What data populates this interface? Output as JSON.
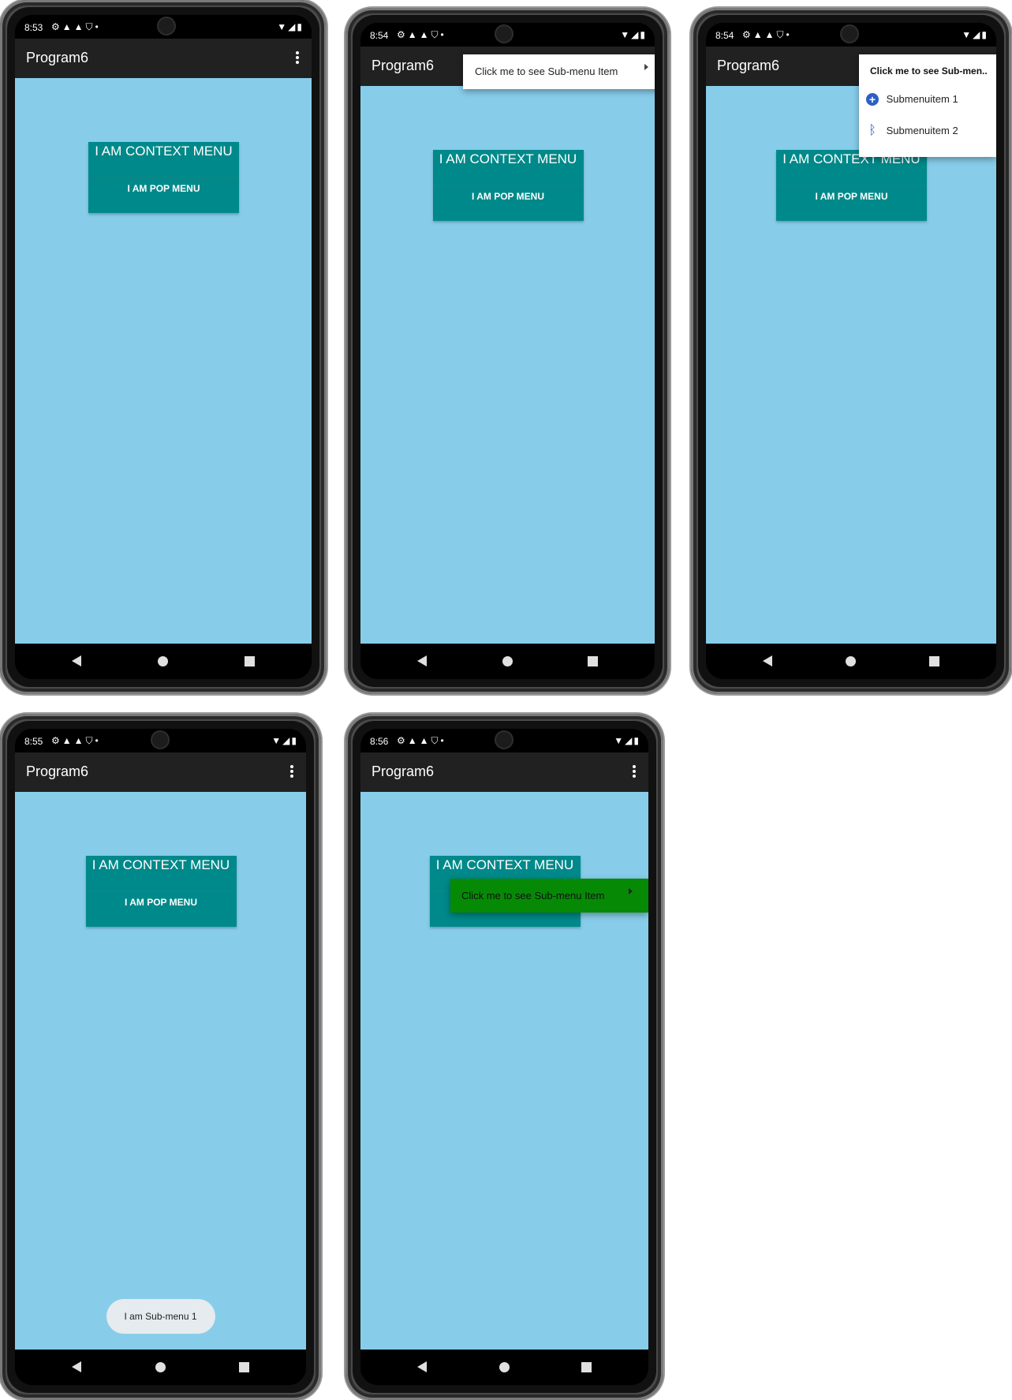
{
  "app": {
    "title": "Program6",
    "context_button_label": "I AM CONTEXT MENU",
    "popup_button_label": "I AM POP MENU"
  },
  "screens": [
    {
      "time": "8:53"
    },
    {
      "time": "8:54",
      "menu_item": "Click me to see Sub-menu Item"
    },
    {
      "time": "8:54",
      "submenu_header": "Click me to see Sub-men..",
      "submenu_items": [
        {
          "label": "Submenuitem 1",
          "icon": "add-circle-icon"
        },
        {
          "label": "Submenuitem 2",
          "icon": "bluetooth-icon"
        }
      ]
    },
    {
      "time": "8:55",
      "toast": "I am Sub-menu 1"
    },
    {
      "time": "8:56",
      "menu_item": "Click me to see Sub-menu Item"
    }
  ],
  "status_icons": [
    "gear-icon",
    "warning-icon",
    "warning-icon",
    "shield-icon",
    "dot-icon"
  ],
  "status_right_icons": [
    "wifi-icon",
    "signal-icon",
    "battery-icon"
  ],
  "colors": {
    "content_bg": "#87cdea",
    "button_bg": "#00898a",
    "appbar_bg": "#212121",
    "green_menu_bg": "#068a06",
    "submenu_icon": "#2d5fc4"
  }
}
